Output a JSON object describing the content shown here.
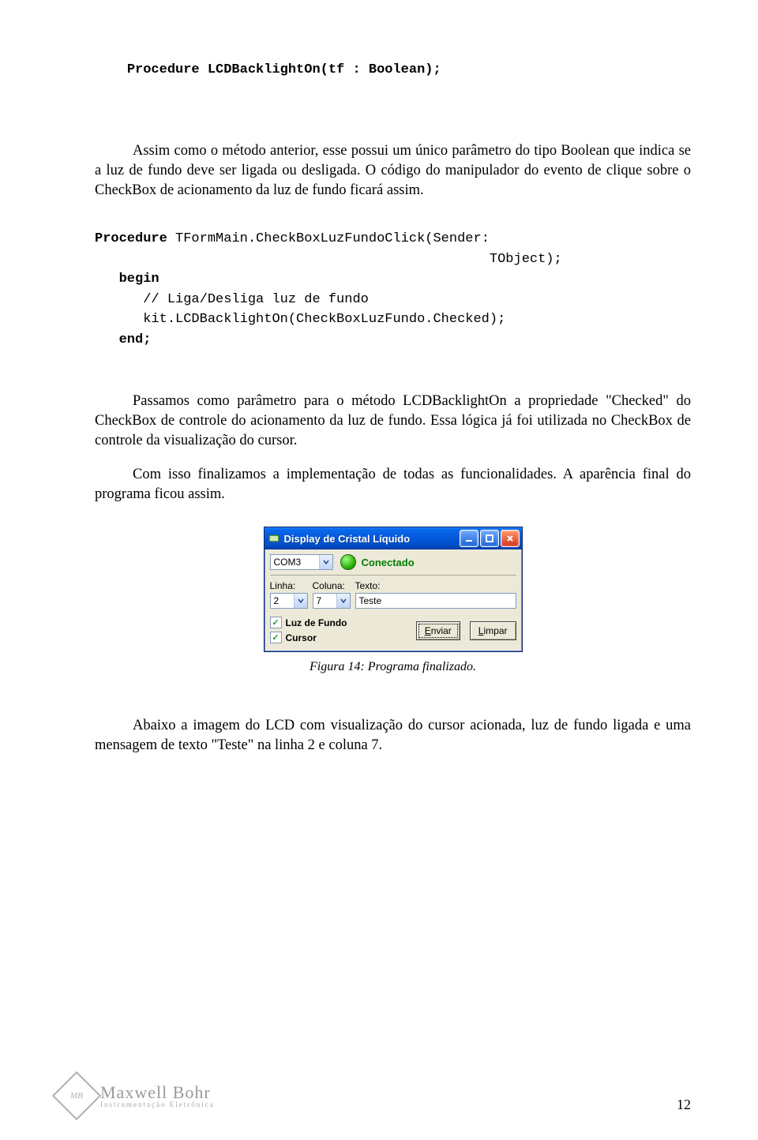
{
  "code1": {
    "line": "Procedure LCDBacklightOn(tf : Boolean);"
  },
  "para1": "Assim como o método anterior, esse possui um único parâmetro do tipo Boolean que indica se a luz de fundo deve ser ligada ou desligada. O código do manipulador do evento de clique sobre o CheckBox de acionamento da luz de fundo ficará assim.",
  "code2": {
    "l1a": "Procedure ",
    "l1b": "TFormMain.CheckBoxLuzFundoClick(Sender:",
    "l2": "TObject);",
    "l3": "begin",
    "l4": "   // Liga/Desliga luz de fundo",
    "l5": "   kit.LCDBacklightOn(CheckBoxLuzFundo.Checked);",
    "l6": "end;"
  },
  "para2": "Passamos como parâmetro para o método LCDBacklightOn a propriedade \"Checked\" do CheckBox de controle do acionamento da luz de fundo. Essa lógica já foi utilizada no CheckBox de controle da visualização do cursor.",
  "para3": "Com isso finalizamos a implementação de todas as funcionalidades. A aparência final do programa ficou assim.",
  "app": {
    "title": "Display de Cristal Líquido",
    "port": "COM3",
    "status": "Conectado",
    "labels": {
      "linha": "Linha:",
      "coluna": "Coluna:",
      "texto": "Texto:"
    },
    "linha": "2",
    "coluna": "7",
    "texto": "Teste",
    "chk1": "Luz de Fundo",
    "chk2": "Cursor",
    "btn_send_u": "E",
    "btn_send": "nviar",
    "btn_clear_u": "L",
    "btn_clear": "impar"
  },
  "caption": "Figura 14: Programa finalizado.",
  "para4": "Abaixo a imagem do LCD com visualização do cursor acionada, luz de fundo ligada e uma mensagem de texto \"Teste\" na linha 2 e coluna 7.",
  "footer": {
    "brand": "Maxwell Bohr",
    "tagline": "Instrumentação Eletrônica",
    "mark": "MB",
    "page": "12"
  }
}
